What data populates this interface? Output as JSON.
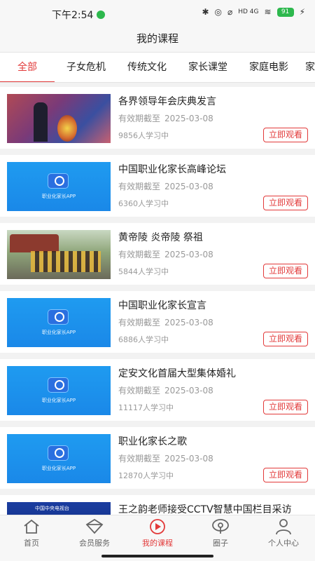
{
  "status_bar": {
    "time": "下午2:54",
    "network": "HD 4G",
    "battery": "91"
  },
  "header": {
    "title": "我的课程"
  },
  "tabs": [
    {
      "label": "全部",
      "active": true
    },
    {
      "label": "子女危机",
      "active": false
    },
    {
      "label": "传统文化",
      "active": false
    },
    {
      "label": "家长课堂",
      "active": false
    },
    {
      "label": "家庭电影",
      "active": false
    },
    {
      "label": "家",
      "active": false
    }
  ],
  "courses": [
    {
      "title": "各界领导年会庆典发言",
      "expiry_label": "有效期截至",
      "expiry_date": "2025-03-08",
      "learners": "9856人学习中",
      "button": "立即观看",
      "thumb": "speech-photo"
    },
    {
      "title": "中国职业化家长高峰论坛",
      "expiry_label": "有效期截至",
      "expiry_date": "2025-03-08",
      "learners": "6360人学习中",
      "button": "立即观看",
      "thumb": "app-logo",
      "thumb_text": "职业化家长APP"
    },
    {
      "title": "黄帝陵 炎帝陵 祭祖",
      "expiry_label": "有效期截至",
      "expiry_date": "2025-03-08",
      "learners": "5844人学习中",
      "button": "立即观看",
      "thumb": "ceremony-photo"
    },
    {
      "title": "中国职业化家长宣言",
      "expiry_label": "有效期截至",
      "expiry_date": "2025-03-08",
      "learners": "6886人学习中",
      "button": "立即观看",
      "thumb": "app-logo",
      "thumb_text": "职业化家长APP"
    },
    {
      "title": "定安文化首届大型集体婚礼",
      "expiry_label": "有效期截至",
      "expiry_date": "2025-03-08",
      "learners": "11117人学习中",
      "button": "立即观看",
      "thumb": "app-logo",
      "thumb_text": "职业化家长APP"
    },
    {
      "title": "职业化家长之歌",
      "expiry_label": "有效期截至",
      "expiry_date": "2025-03-08",
      "learners": "12870人学习中",
      "button": "立即观看",
      "thumb": "app-logo",
      "thumb_text": "职业化家长APP"
    },
    {
      "title": "王之韵老师接受CCTV智慧中国栏目采访",
      "thumb": "tv-photo",
      "thumb_text": "中国中央电视台"
    }
  ],
  "bottom_nav": [
    {
      "label": "首页",
      "icon": "home-icon",
      "active": false
    },
    {
      "label": "会员服务",
      "icon": "diamond-icon",
      "active": false
    },
    {
      "label": "我的课程",
      "icon": "play-circle-icon",
      "active": true
    },
    {
      "label": "圈子",
      "icon": "circle-pin-icon",
      "active": false
    },
    {
      "label": "个人中心",
      "icon": "person-icon",
      "active": false
    }
  ],
  "colors": {
    "accent": "#e23a3a",
    "thumb_blue": "#1f9bf0",
    "muted_text": "#999999"
  }
}
